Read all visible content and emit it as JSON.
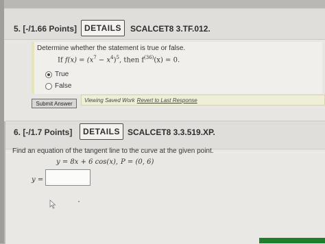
{
  "q5": {
    "number": "5. [-/1.66 Points]",
    "details_label": "DETAILS",
    "code": "SCALCET8 3.TF.012.",
    "instruction": "Determine whether the statement is true or false.",
    "statement": {
      "if": "If",
      "fx": "f(x) = (x",
      "exp7": "7",
      "minus": " − x",
      "exp4": "4",
      "close": ")",
      "exp5": "5",
      "then": ",  then  f",
      "deriv": "(36)",
      "tail": "(x) = 0."
    },
    "options": [
      {
        "label": "True",
        "selected": true
      },
      {
        "label": "False",
        "selected": false
      }
    ],
    "submit_label": "Submit Answer",
    "saved_text": "Viewing Saved Work",
    "saved_link": "Revert to Last Response"
  },
  "q6": {
    "number": "6. [-/1.7 Points]",
    "details_label": "DETAILS",
    "code": "SCALCET8 3.3.519.XP.",
    "instruction": "Find an equation of the tangent line to the curve at the given point.",
    "equation": "y = 8x + 6 cos(x),",
    "point": "P = (0, 6)",
    "answer_label": "y =",
    "answer_value": ""
  },
  "colors": {
    "accent_strip": "#e7e4b6",
    "submit_bg": "#d8d7d3",
    "green": "#1f7d2e"
  }
}
